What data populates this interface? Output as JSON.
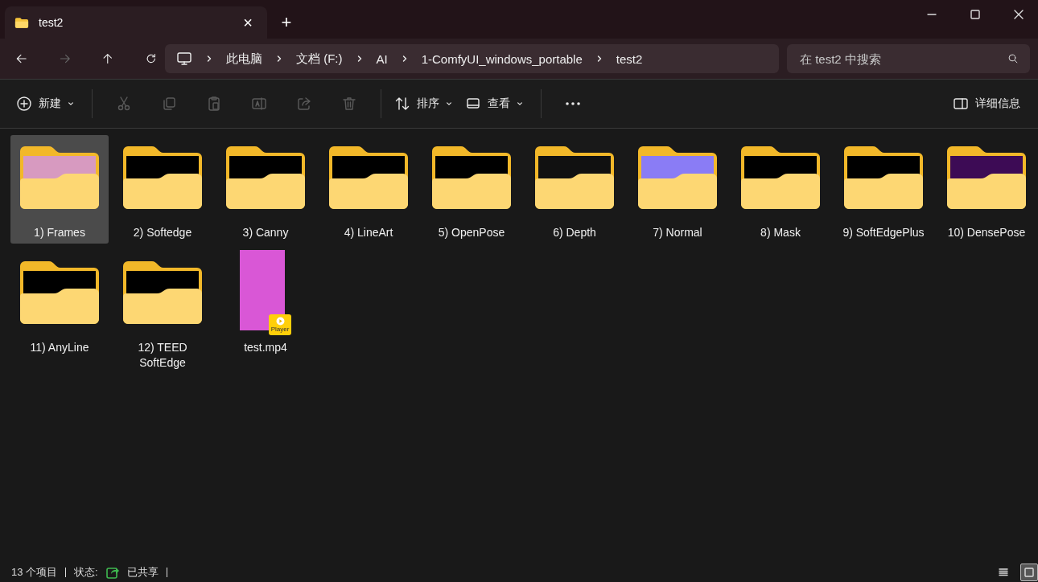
{
  "tab": {
    "title": "test2",
    "close": "×",
    "new": "+"
  },
  "address": {
    "segments": [
      "此电脑",
      "文档 (F:)",
      "AI",
      "1-ComfyUI_windows_portable",
      "test2"
    ]
  },
  "search": {
    "placeholder": "在 test2 中搜索"
  },
  "toolbar": [
    {
      "kind": "menu",
      "label": "新建"
    },
    {
      "kind": "sep"
    },
    {
      "kind": "icon",
      "disabled": true
    },
    {
      "kind": "icon",
      "disabled": true
    },
    {
      "kind": "icon",
      "disabled": true
    },
    {
      "kind": "icon",
      "disabled": true
    },
    {
      "kind": "icon",
      "disabled": true
    },
    {
      "kind": "icon",
      "disabled": true
    },
    {
      "kind": "sep"
    },
    {
      "kind": "menu",
      "label": "排序"
    },
    {
      "kind": "menu",
      "label": "查看"
    },
    {
      "kind": "sep"
    },
    {
      "kind": "more"
    }
  ],
  "details_button": "详细信息",
  "items": [
    {
      "kind": "folder",
      "name": "1) Frames",
      "selected": true,
      "color": "#d79ac0"
    },
    {
      "kind": "folder",
      "name": "2) Softedge",
      "selected": false,
      "color": "#000000"
    },
    {
      "kind": "folder",
      "name": "3) Canny",
      "selected": false,
      "color": "#000000"
    },
    {
      "kind": "folder",
      "name": "4) LineArt",
      "selected": false,
      "color": "#000000"
    },
    {
      "kind": "folder",
      "name": "5) OpenPose",
      "selected": false,
      "color": "#000000"
    },
    {
      "kind": "folder",
      "name": "6) Depth",
      "selected": false,
      "color": "#111111"
    },
    {
      "kind": "folder",
      "name": "7) Normal",
      "selected": false,
      "color": "#8a7cf5"
    },
    {
      "kind": "folder",
      "name": "8) Mask",
      "selected": false,
      "color": "#000000"
    },
    {
      "kind": "folder",
      "name": "9) SoftEdgePlus",
      "selected": false,
      "color": "#000000"
    },
    {
      "kind": "folder",
      "name": "10) DensePose",
      "selected": false,
      "color": "#3d0b55"
    },
    {
      "kind": "folder",
      "name": "11) AnyLine",
      "selected": false,
      "color": "#000000"
    },
    {
      "kind": "folder",
      "name": "12) TEED SoftEdge",
      "selected": false,
      "color": "#000000"
    },
    {
      "kind": "video",
      "name": "test.mp4",
      "selected": false,
      "color": "#d957d6",
      "badge": "Player"
    }
  ],
  "status_bar": {
    "count": "13 个项目",
    "state_label": "状态:",
    "state": "已共享",
    "views": [
      {
        "kind": "details",
        "selected": false
      },
      {
        "kind": "tiles",
        "selected": true
      }
    ]
  }
}
